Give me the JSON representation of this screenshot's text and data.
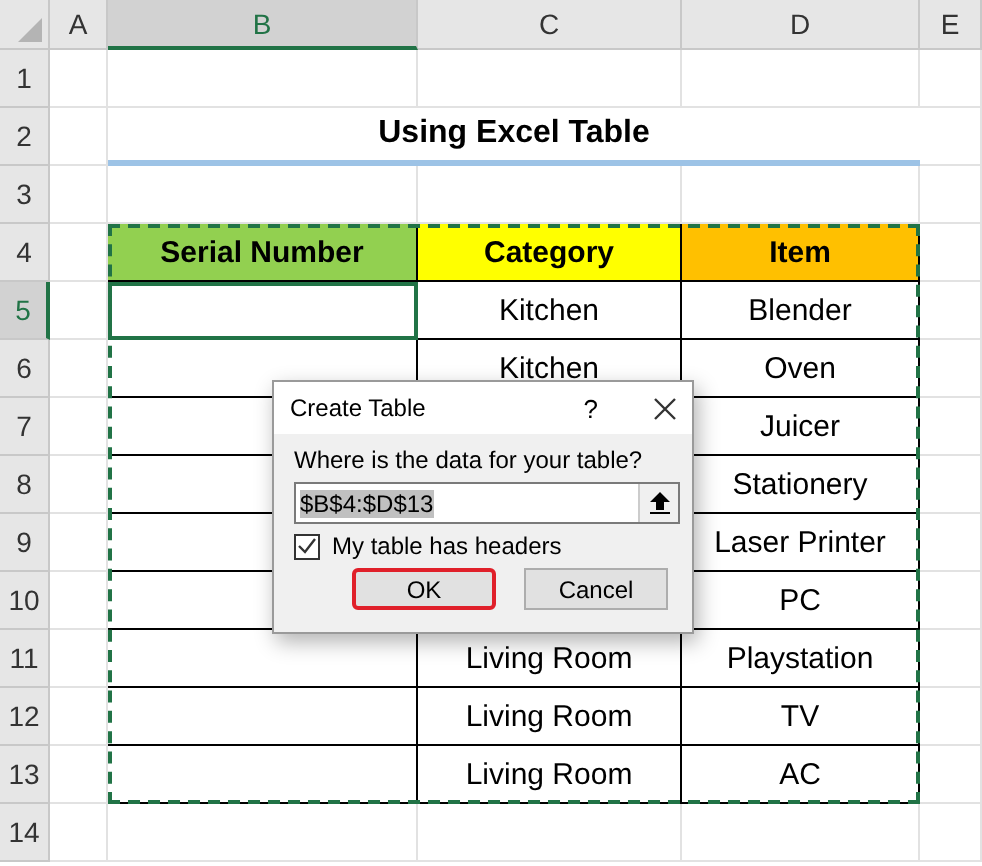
{
  "columns": [
    {
      "label": "A",
      "selected": false
    },
    {
      "label": "B",
      "selected": true
    },
    {
      "label": "C",
      "selected": false
    },
    {
      "label": "D",
      "selected": false
    },
    {
      "label": "E",
      "selected": false
    }
  ],
  "rows": [
    {
      "label": "1",
      "selected": false
    },
    {
      "label": "2",
      "selected": false
    },
    {
      "label": "3",
      "selected": false
    },
    {
      "label": "4",
      "selected": false
    },
    {
      "label": "5",
      "selected": true
    },
    {
      "label": "6",
      "selected": false
    },
    {
      "label": "7",
      "selected": false
    },
    {
      "label": "8",
      "selected": false
    },
    {
      "label": "9",
      "selected": false
    },
    {
      "label": "10",
      "selected": false
    },
    {
      "label": "11",
      "selected": false
    },
    {
      "label": "12",
      "selected": false
    },
    {
      "label": "13",
      "selected": false
    },
    {
      "label": "14",
      "selected": false
    }
  ],
  "title": "Using Excel Table",
  "table": {
    "headers": [
      {
        "text": "Serial Number",
        "color": "#92d050"
      },
      {
        "text": "Category",
        "color": "#ffff00"
      },
      {
        "text": "Item",
        "color": "#ffc000"
      }
    ],
    "rows": [
      {
        "selected": true,
        "category": "Kitchen",
        "item": "Blender"
      },
      {
        "selected": false,
        "category": "Kitchen",
        "item": "Oven"
      },
      {
        "selected": false,
        "item": "Juicer"
      },
      {
        "selected": false,
        "item": "Stationery"
      },
      {
        "selected": false,
        "item": "Laser Printer"
      },
      {
        "selected": false,
        "item": "PC"
      },
      {
        "selected": false,
        "category": "Living Room",
        "item": "Playstation"
      },
      {
        "selected": false,
        "category": "Living Room",
        "item": "TV"
      },
      {
        "selected": false,
        "category": "Living Room",
        "item": "AC"
      }
    ]
  },
  "dialog": {
    "title": "Create Table",
    "help": "?",
    "label": "Where is the data for your table?",
    "value": "$B$4:$D$13",
    "checkbox": {
      "label": "My table has headers",
      "checked": true
    },
    "buttons": [
      {
        "label": "OK",
        "highlighted": true
      },
      {
        "label": "Cancel",
        "highlighted": false
      }
    ]
  }
}
